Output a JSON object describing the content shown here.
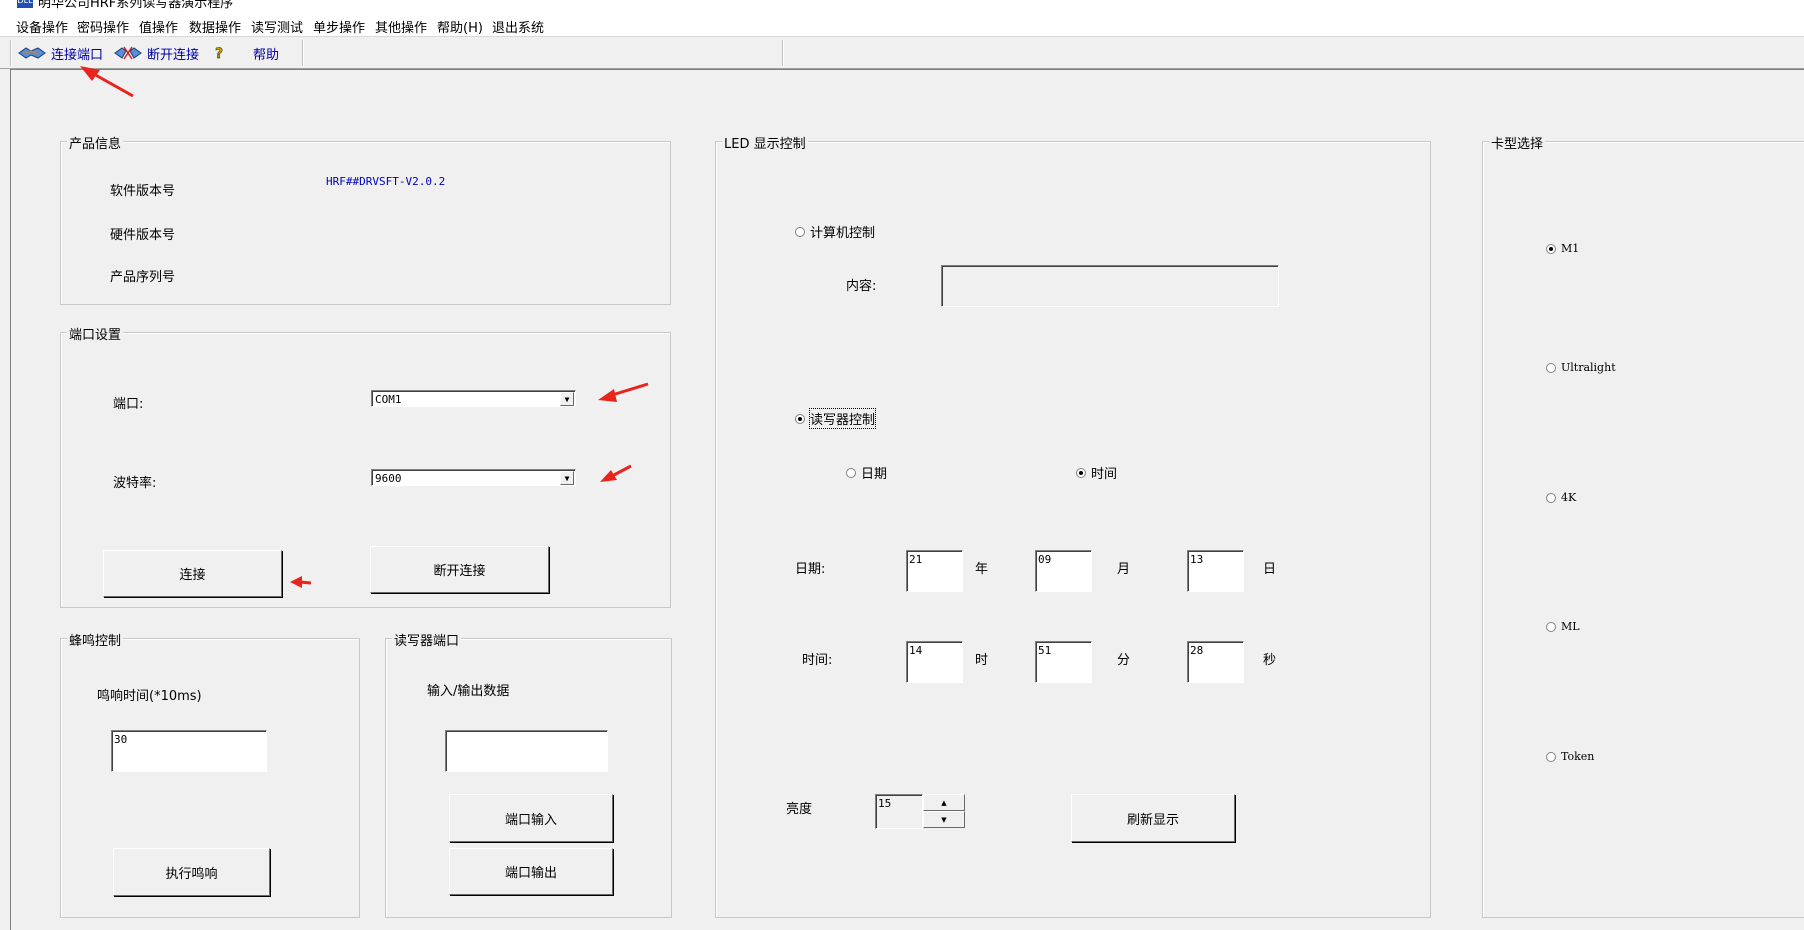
{
  "window": {
    "title": "明华公司HRF系列读写器演示程序",
    "icon_text": "DLL"
  },
  "menu": [
    "设备操作",
    "密码操作",
    "值操作",
    "数据操作",
    "读写测试",
    "单步操作",
    "其他操作",
    "帮助(H)",
    "退出系统"
  ],
  "toolbar": {
    "connect_label": "连接端口",
    "disconnect_label": "断开连接",
    "help_label": "帮助"
  },
  "product_info": {
    "title": "产品信息",
    "software_version_label": "软件版本号",
    "software_version_value": "HRF##DRVSFT-V2.0.2",
    "hardware_version_label": "硬件版本号",
    "serial_label": "产品序列号"
  },
  "port_settings": {
    "title": "端口设置",
    "port_label": "端口:",
    "port_value": "COM1",
    "baud_label": "波特率:",
    "baud_value": "9600",
    "connect_button": "连接",
    "disconnect_button": "断开连接"
  },
  "beep": {
    "title": "蜂鸣控制",
    "duration_label": "鸣响时间(*10ms)",
    "duration_value": "30",
    "execute_button": "执行鸣响"
  },
  "reader_port": {
    "title": "读写器端口",
    "io_label": "输入/输出数据",
    "io_value": "",
    "input_button": "端口输入",
    "output_button": "端口输出"
  },
  "led": {
    "title": "LED 显示控制",
    "pc_control": "计算机控制",
    "content_label": "内容:",
    "content_value": "",
    "reader_control": "读写器控制",
    "date_option": "日期",
    "time_option": "时间",
    "date_label": "日期:",
    "year": "21",
    "year_unit": "年",
    "month": "09",
    "month_unit": "月",
    "day": "13",
    "day_unit": "日",
    "time_label": "时间:",
    "hour": "14",
    "hour_unit": "时",
    "minute": "51",
    "minute_unit": "分",
    "second": "28",
    "second_unit": "秒",
    "brightness_label": "亮度",
    "brightness_value": "15",
    "refresh_button": "刷新显示"
  },
  "card_type": {
    "title": "卡型选择",
    "options": [
      "M1",
      "Ultralight",
      "4K",
      "ML",
      "Token"
    ],
    "selected": "M1"
  },
  "colors": {
    "annotation_arrow": "#e8241c",
    "link_text": "#0000c0"
  }
}
